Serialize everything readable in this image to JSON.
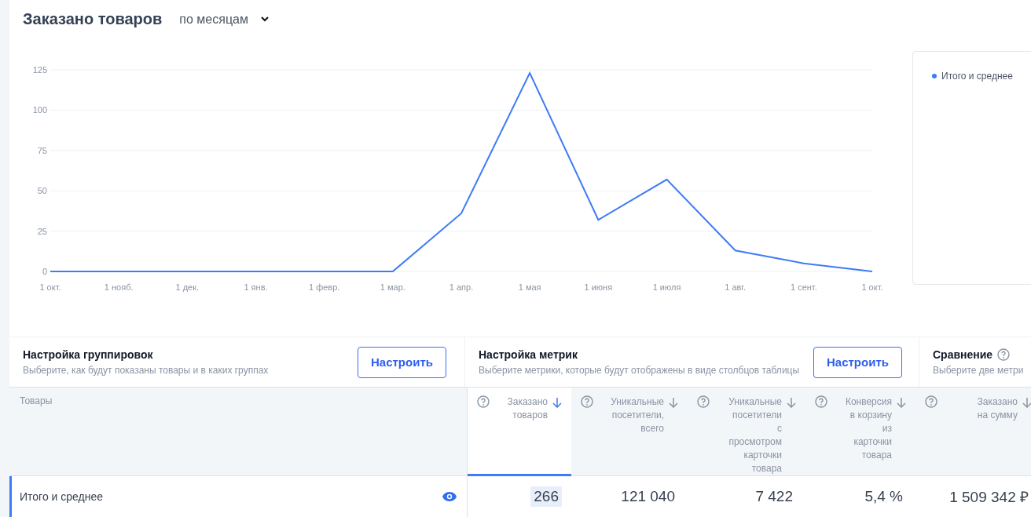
{
  "header": {
    "title": "Заказано товаров",
    "period": "по месяцам"
  },
  "chart": {
    "chart_data": {
      "type": "line",
      "categories": [
        "1 окт.",
        "1 нояб.",
        "1 дек.",
        "1 янв.",
        "1 февр.",
        "1 мар.",
        "1 апр.",
        "1 мая",
        "1 июня",
        "1 июля",
        "1 авг.",
        "1 сент.",
        "1 окт."
      ],
      "ylim": [
        0,
        125
      ],
      "grid": true,
      "yticks": [
        0,
        25,
        50,
        75,
        100,
        125
      ],
      "series": [
        {
          "name": "Итого и среднее",
          "color": "#3d7bf7",
          "values": [
            0,
            0,
            0,
            0,
            0,
            0,
            36,
            123,
            32,
            57,
            13,
            5,
            0
          ]
        }
      ]
    }
  },
  "settings": [
    {
      "kind": "button",
      "title": "Настройка группировок",
      "subtitle": "Выберите, как будут показаны товары и в каких группах",
      "button": "Настроить"
    },
    {
      "kind": "button",
      "title": "Настройка метрик",
      "subtitle": "Выберите метрики, которые будут отображены в виде столбцов таблицы",
      "button": "Настроить"
    },
    {
      "kind": "help",
      "title": "Сравнение",
      "subtitle": "Выберите две метри"
    }
  ],
  "table": {
    "name_column": "Товары",
    "columns": [
      {
        "label": "Заказано\nтоваров",
        "selected": true
      },
      {
        "label": "Уникальные\nпосетители,\nвсего",
        "selected": false
      },
      {
        "label": "Уникальные\nпосетители\nс\nпросмотром\nкарточки\nтовара",
        "selected": false
      },
      {
        "label": "Конверсия\nв корзину\nиз\nкарточки\nтовара",
        "selected": false
      },
      {
        "label": "Заказано\nна сумму",
        "selected": false
      }
    ],
    "rows": [
      {
        "label": "Итого и среднее",
        "selected": true,
        "values": [
          "266",
          "121 040",
          "7 422",
          "5,4 %",
          "1 509 342 ₽"
        ]
      }
    ]
  }
}
